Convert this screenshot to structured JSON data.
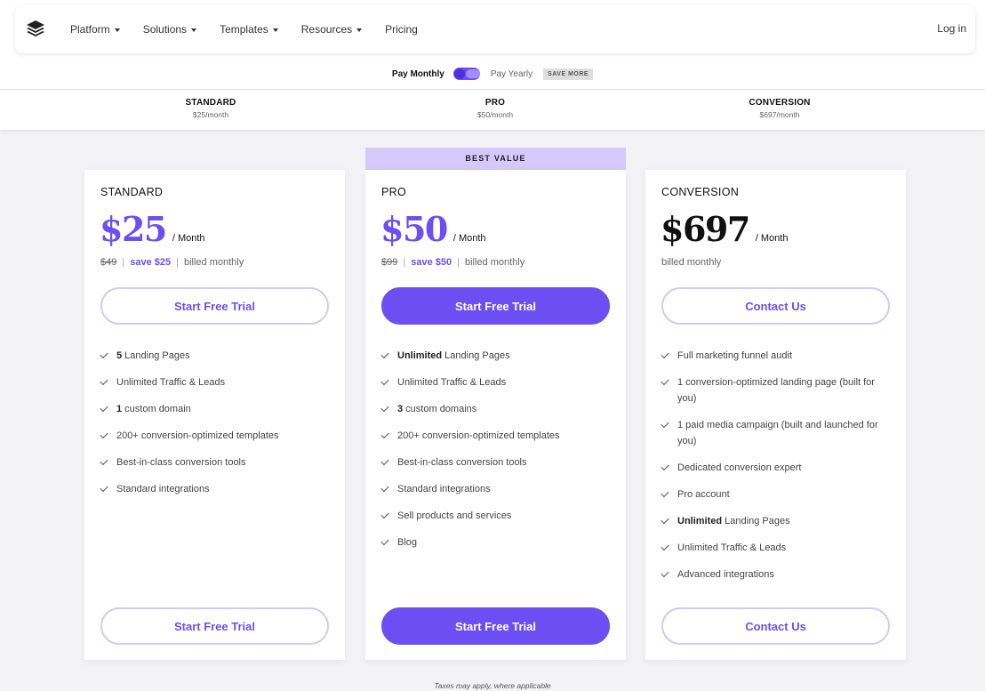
{
  "nav": {
    "items": [
      {
        "label": "Platform",
        "dropdown": true
      },
      {
        "label": "Solutions",
        "dropdown": true
      },
      {
        "label": "Templates",
        "dropdown": true
      },
      {
        "label": "Resources",
        "dropdown": true
      },
      {
        "label": "Pricing",
        "dropdown": false
      }
    ],
    "login": "Log in",
    "logo_icon": "layers-logo-icon"
  },
  "billing": {
    "monthly": "Pay Monthly",
    "yearly": "Pay Yearly",
    "badge": "SAVE MORE"
  },
  "strip": [
    {
      "name": "STANDARD",
      "price": "$25/month"
    },
    {
      "name": "PRO",
      "price": "$50/month"
    },
    {
      "name": "CONVERSION",
      "price": "$697/month"
    }
  ],
  "best_value": "BEST VALUE",
  "plans": [
    {
      "name": "STANDARD",
      "price": "$25",
      "per": "/ Month",
      "old_price": "$49",
      "save": "save $25",
      "billed": "billed monthly",
      "cta": "Start Free Trial",
      "features": [
        {
          "bold": "5",
          "text": " Landing Pages"
        },
        {
          "bold": "",
          "text": "Unlimited Traffic & Leads"
        },
        {
          "bold": "1",
          "text": " custom domain"
        },
        {
          "bold": "",
          "text": "200+ conversion-optimized templates"
        },
        {
          "bold": "",
          "text": "Best-in-class conversion tools"
        },
        {
          "bold": "",
          "text": "Standard integrations"
        }
      ]
    },
    {
      "name": "PRO",
      "price": "$50",
      "per": "/ Month",
      "old_price": "$99",
      "save": "save $50",
      "billed": "billed monthly",
      "cta": "Start Free Trial",
      "features": [
        {
          "bold": "Unlimited",
          "text": " Landing Pages"
        },
        {
          "bold": "",
          "text": "Unlimited Traffic & Leads"
        },
        {
          "bold": "3",
          "text": " custom domains"
        },
        {
          "bold": "",
          "text": "200+ conversion-optimized templates"
        },
        {
          "bold": "",
          "text": "Best-in-class conversion tools"
        },
        {
          "bold": "",
          "text": "Standard integrations"
        },
        {
          "bold": "",
          "text": "Sell products and services"
        },
        {
          "bold": "",
          "text": "Blog"
        }
      ]
    },
    {
      "name": "CONVERSION",
      "price": "$697",
      "per": "/ Month",
      "billed": "billed monthly",
      "cta": "Contact Us",
      "features": [
        {
          "bold": "",
          "text": "Full marketing funnel audit"
        },
        {
          "bold": "",
          "text": "1 conversion-optimized landing page (built for you)"
        },
        {
          "bold": "",
          "text": "1 paid media campaign (built and launched for you)"
        },
        {
          "bold": "",
          "text": "Dedicated conversion expert"
        },
        {
          "bold": "",
          "text": "Pro account"
        },
        {
          "bold": "Unlimited",
          "text": " Landing Pages"
        },
        {
          "bold": "",
          "text": "Unlimited Traffic & Leads"
        },
        {
          "bold": "",
          "text": "Advanced integrations"
        }
      ]
    }
  ],
  "footnote": "Taxes may apply, where applicable",
  "colors": {
    "accent": "#6c4ff3",
    "badge_bg": "#d4c9fb",
    "page_bg": "#f3f3f5"
  }
}
